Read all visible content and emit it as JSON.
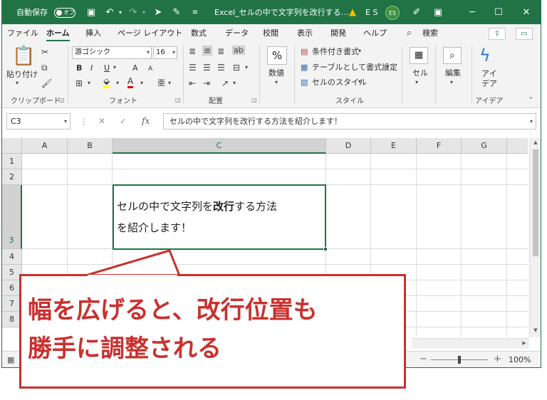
{
  "titlebar": {
    "autosave_label": "自動保存",
    "autosave_state": "オフ",
    "document_title": "Excel_セルの中で文字列を改行する…",
    "user_initials_text": "E S",
    "avatar_initials": "ES",
    "icons": [
      "save-icon",
      "undo-icon",
      "redo-icon",
      "pointer-icon",
      "brush-icon",
      "customize-icon",
      "warning-icon",
      "pen-icon",
      "ribbon-display-icon",
      "minimize-icon",
      "restore-icon",
      "close-icon"
    ]
  },
  "menu": {
    "tabs": [
      "ファイル",
      "ホーム",
      "挿入",
      "ページ レイアウト",
      "数式",
      "データ",
      "校閲",
      "表示",
      "開発",
      "ヘルプ"
    ],
    "active_tab": "ホーム",
    "search_label": "検索"
  },
  "ribbon": {
    "clipboard": {
      "paste_label": "貼り付け",
      "group_label": "クリップボード"
    },
    "font": {
      "font_name": "游ゴシック",
      "font_size": "16",
      "group_label": "フォント",
      "bold": "B",
      "italic": "I",
      "underline": "U",
      "grow": "A",
      "shrink": "A"
    },
    "alignment": {
      "group_label": "配置"
    },
    "number": {
      "label": "数値",
      "symbol": "%"
    },
    "styles": {
      "conditional_format": "条件付き書式",
      "format_as_table": "テーブルとして書式設定",
      "cell_styles": "セルのスタイル",
      "group_label": "スタイル"
    },
    "cells": {
      "label": "セル"
    },
    "editing": {
      "label": "編集"
    },
    "ideas": {
      "label_line1": "アイ",
      "label_line2": "デア",
      "group_label": "アイデア"
    }
  },
  "formula_bar": {
    "name_box": "C3",
    "formula": "セルの中で文字列を改行する方法を紹介します！",
    "fx_label": "fx"
  },
  "grid": {
    "columns": [
      "A",
      "B",
      "C",
      "D",
      "E",
      "F",
      "G"
    ],
    "rows": [
      "1",
      "2",
      "3",
      "4",
      "5",
      "6",
      "7",
      "8"
    ],
    "selected_column": "C",
    "selected_row": "3",
    "cell_c3": {
      "part1": "セルの中で文字列を",
      "bold_part": "改行",
      "part2": "する方法",
      "part3": "を紹介します！"
    }
  },
  "status": {
    "zoom": "100%"
  },
  "callout": {
    "line1": "幅を広げると、改行位置も",
    "line2": "勝手に調整される",
    "color": "#c8312e"
  },
  "colors": {
    "accent": "#217346"
  }
}
